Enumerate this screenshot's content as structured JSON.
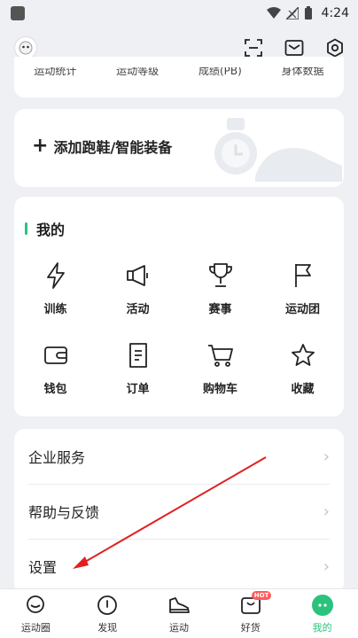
{
  "status_bar": {
    "time": "4:24"
  },
  "stats": [
    "运动统计",
    "运动等级",
    "成绩(PB)",
    "身体数据"
  ],
  "gear": {
    "label": "添加跑鞋/智能装备"
  },
  "mine": {
    "title": "我的",
    "items": [
      {
        "label": "训练",
        "icon": "lightning-icon"
      },
      {
        "label": "活动",
        "icon": "megaphone-icon"
      },
      {
        "label": "赛事",
        "icon": "trophy-icon"
      },
      {
        "label": "运动团",
        "icon": "flag-icon"
      },
      {
        "label": "钱包",
        "icon": "wallet-icon"
      },
      {
        "label": "订单",
        "icon": "order-icon"
      },
      {
        "label": "购物车",
        "icon": "cart-icon"
      },
      {
        "label": "收藏",
        "icon": "star-icon"
      }
    ]
  },
  "list": [
    "企业服务",
    "帮助与反馈",
    "设置"
  ],
  "nav": {
    "items": [
      "运动圈",
      "发现",
      "运动",
      "好货",
      "我的"
    ],
    "hot_badge": "HOT",
    "active_index": 4
  },
  "colors": {
    "accent": "#2bc27c",
    "arrow": "#e02020"
  }
}
